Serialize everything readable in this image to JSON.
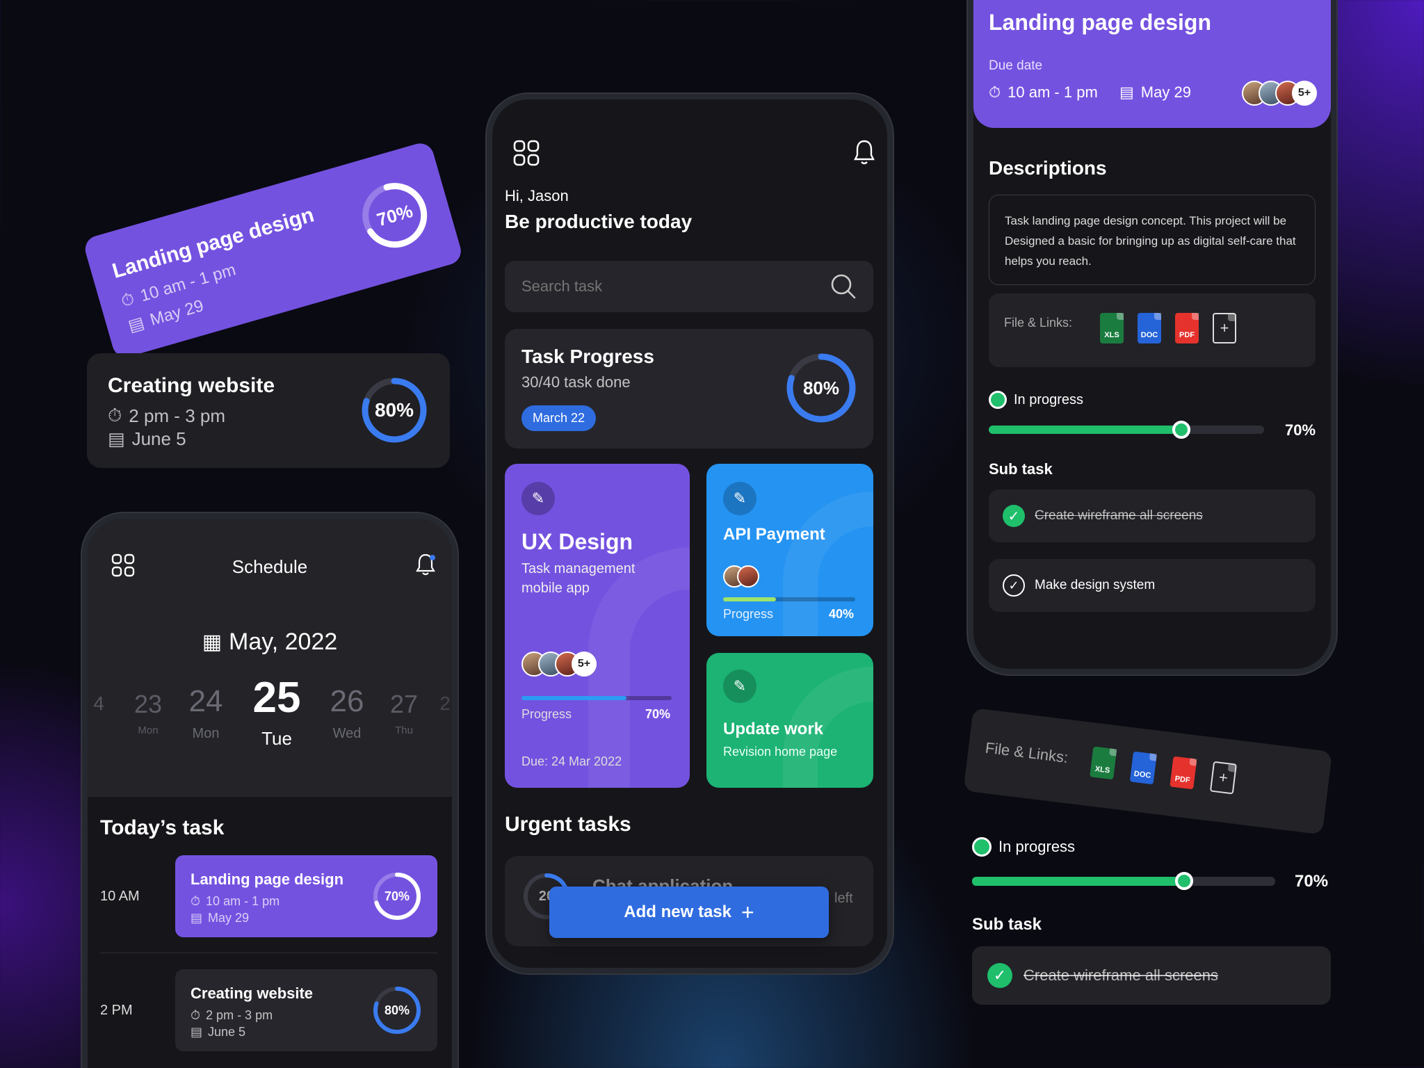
{
  "colors": {
    "accent_purple": "#7452e0",
    "accent_blue": "#2493f2",
    "accent_green": "#1cb374",
    "progress_blue": "#3a7bf0",
    "progress_green": "#1fbf6c",
    "button_blue": "#2f6ce0"
  },
  "floating_tilted_card": {
    "title": "Landing page design",
    "time": "10 am - 1 pm",
    "date": "May 29",
    "progress_label": "70%",
    "progress": 0.7
  },
  "floating_card": {
    "title": "Creating website",
    "time": "2 pm - 3 pm",
    "date": "June 5",
    "progress_label": "80%",
    "progress": 0.8
  },
  "schedule_phone": {
    "title": "Schedule",
    "month": "May, 2022",
    "days": [
      {
        "num": "4",
        "name": ""
      },
      {
        "num": "23",
        "name": "Mon"
      },
      {
        "num": "24",
        "name": "Mon"
      },
      {
        "num": "25",
        "name": "Tue"
      },
      {
        "num": "26",
        "name": "Wed"
      },
      {
        "num": "27",
        "name": "Thu"
      },
      {
        "num": "2",
        "name": ""
      }
    ],
    "todays_task_heading": "Today’s task",
    "tasks": [
      {
        "time": "10 AM",
        "title": "Landing page design",
        "slot": "10 am - 1 pm",
        "date": "May 29",
        "progress_label": "70%",
        "progress": 0.7
      },
      {
        "time": "2 PM",
        "title": "Creating website",
        "slot": "2 pm - 3 pm",
        "date": "June 5",
        "progress_label": "80%",
        "progress": 0.8
      }
    ]
  },
  "home_phone": {
    "greeting": "Hi, Jason",
    "headline": "Be productive today",
    "search_placeholder": "Search task",
    "task_progress": {
      "title": "Task Progress",
      "subtitle": "30/40 task done",
      "badge": "March 22",
      "progress_label": "80%",
      "progress": 0.8
    },
    "ux_card": {
      "title": "UX Design",
      "subtitle_line1": "Task management",
      "subtitle_line2": "mobile app",
      "more_badge": "5+",
      "progress_text": "Progress",
      "progress_label": "70%",
      "progress": 0.7,
      "due": "Due: 24 Mar 2022"
    },
    "api_card": {
      "title": "API Payment",
      "progress_text": "Progress",
      "progress_label": "40%",
      "progress": 0.4
    },
    "update_card": {
      "title": "Update work",
      "subtitle": "Revision home page"
    },
    "urgent_heading": "Urgent tasks",
    "urgent_item": {
      "ring_label": "20",
      "title": "Chat application",
      "remaining": "left"
    },
    "add_button": "Add new task"
  },
  "detail_phone": {
    "title": "Landing page design",
    "due_label": "Due date",
    "time": "10 am - 1 pm",
    "date": "May 29",
    "more_badge": "5+",
    "descriptions_heading": "Descriptions",
    "description": "Task landing page design concept. This project will be Designed a basic for bringing up as digital self-care that helps you reach.",
    "files_label": "File & Links:",
    "files": [
      "XLS",
      "DOC",
      "PDF"
    ],
    "status": "In progress",
    "progress_label": "70%",
    "progress": 0.7,
    "subtask_heading": "Sub task",
    "subtasks": [
      {
        "label": "Create wireframe all screens",
        "done": true
      },
      {
        "label": "Make design system",
        "done": false
      }
    ]
  },
  "floating_files": {
    "label": "File & Links:",
    "files": [
      "XLS",
      "DOC",
      "PDF"
    ]
  },
  "floating_progress": {
    "status": "In progress",
    "progress_label": "70%",
    "progress": 0.7,
    "subtask_heading": "Sub task",
    "subtask": "Create wireframe all screens"
  }
}
